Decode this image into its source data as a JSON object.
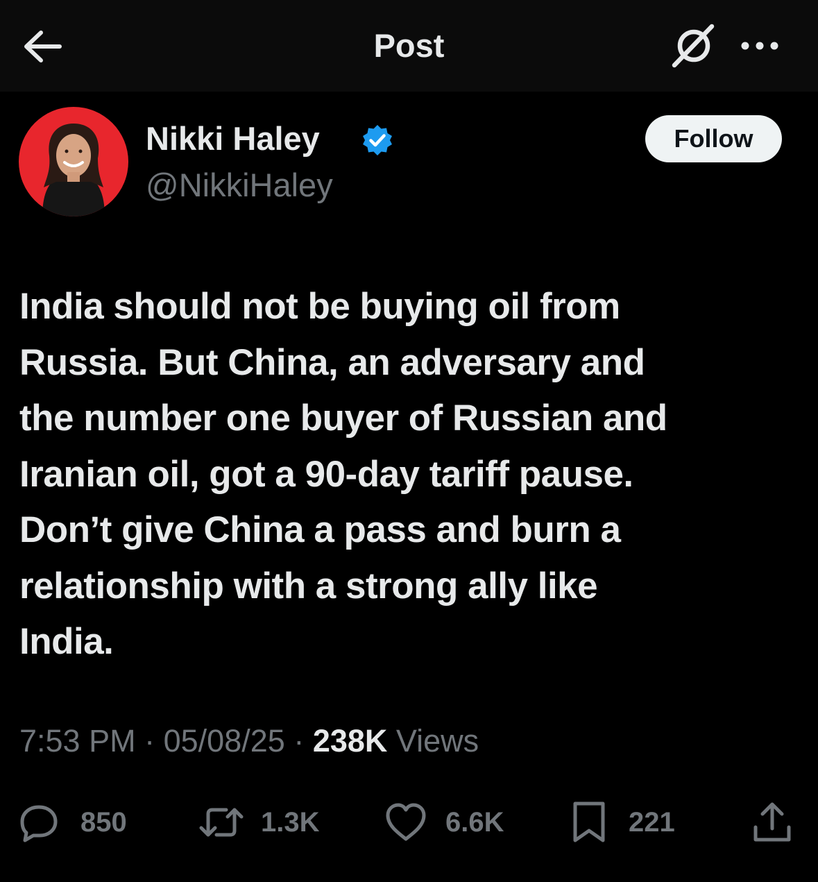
{
  "header": {
    "title": "Post"
  },
  "author": {
    "name": "Nikki Haley",
    "handle": "@NikkiHaley",
    "avatar_bg": "#e8262d"
  },
  "follow_label": "Follow",
  "tweet": {
    "text": "India should not be buying oil from\nRussia. But China, an adversary and\nthe number one buyer of Russian and\nIranian oil, got a 90-day tariff pause.\nDon’t give China a pass and burn a\nrelationship with a strong ally like\nIndia."
  },
  "meta": {
    "time": "7:53 PM",
    "date": "05/08/25",
    "views_count": "238K",
    "views_label": "Views",
    "separator": "·"
  },
  "actions": {
    "replies": "850",
    "reposts": "1.3K",
    "likes": "6.6K",
    "bookmarks": "221"
  },
  "colors": {
    "background": "#000000",
    "text": "#e7e9ea",
    "muted": "#71767b",
    "verified": "#1d9bf0",
    "follow_bg": "#eff3f4"
  }
}
